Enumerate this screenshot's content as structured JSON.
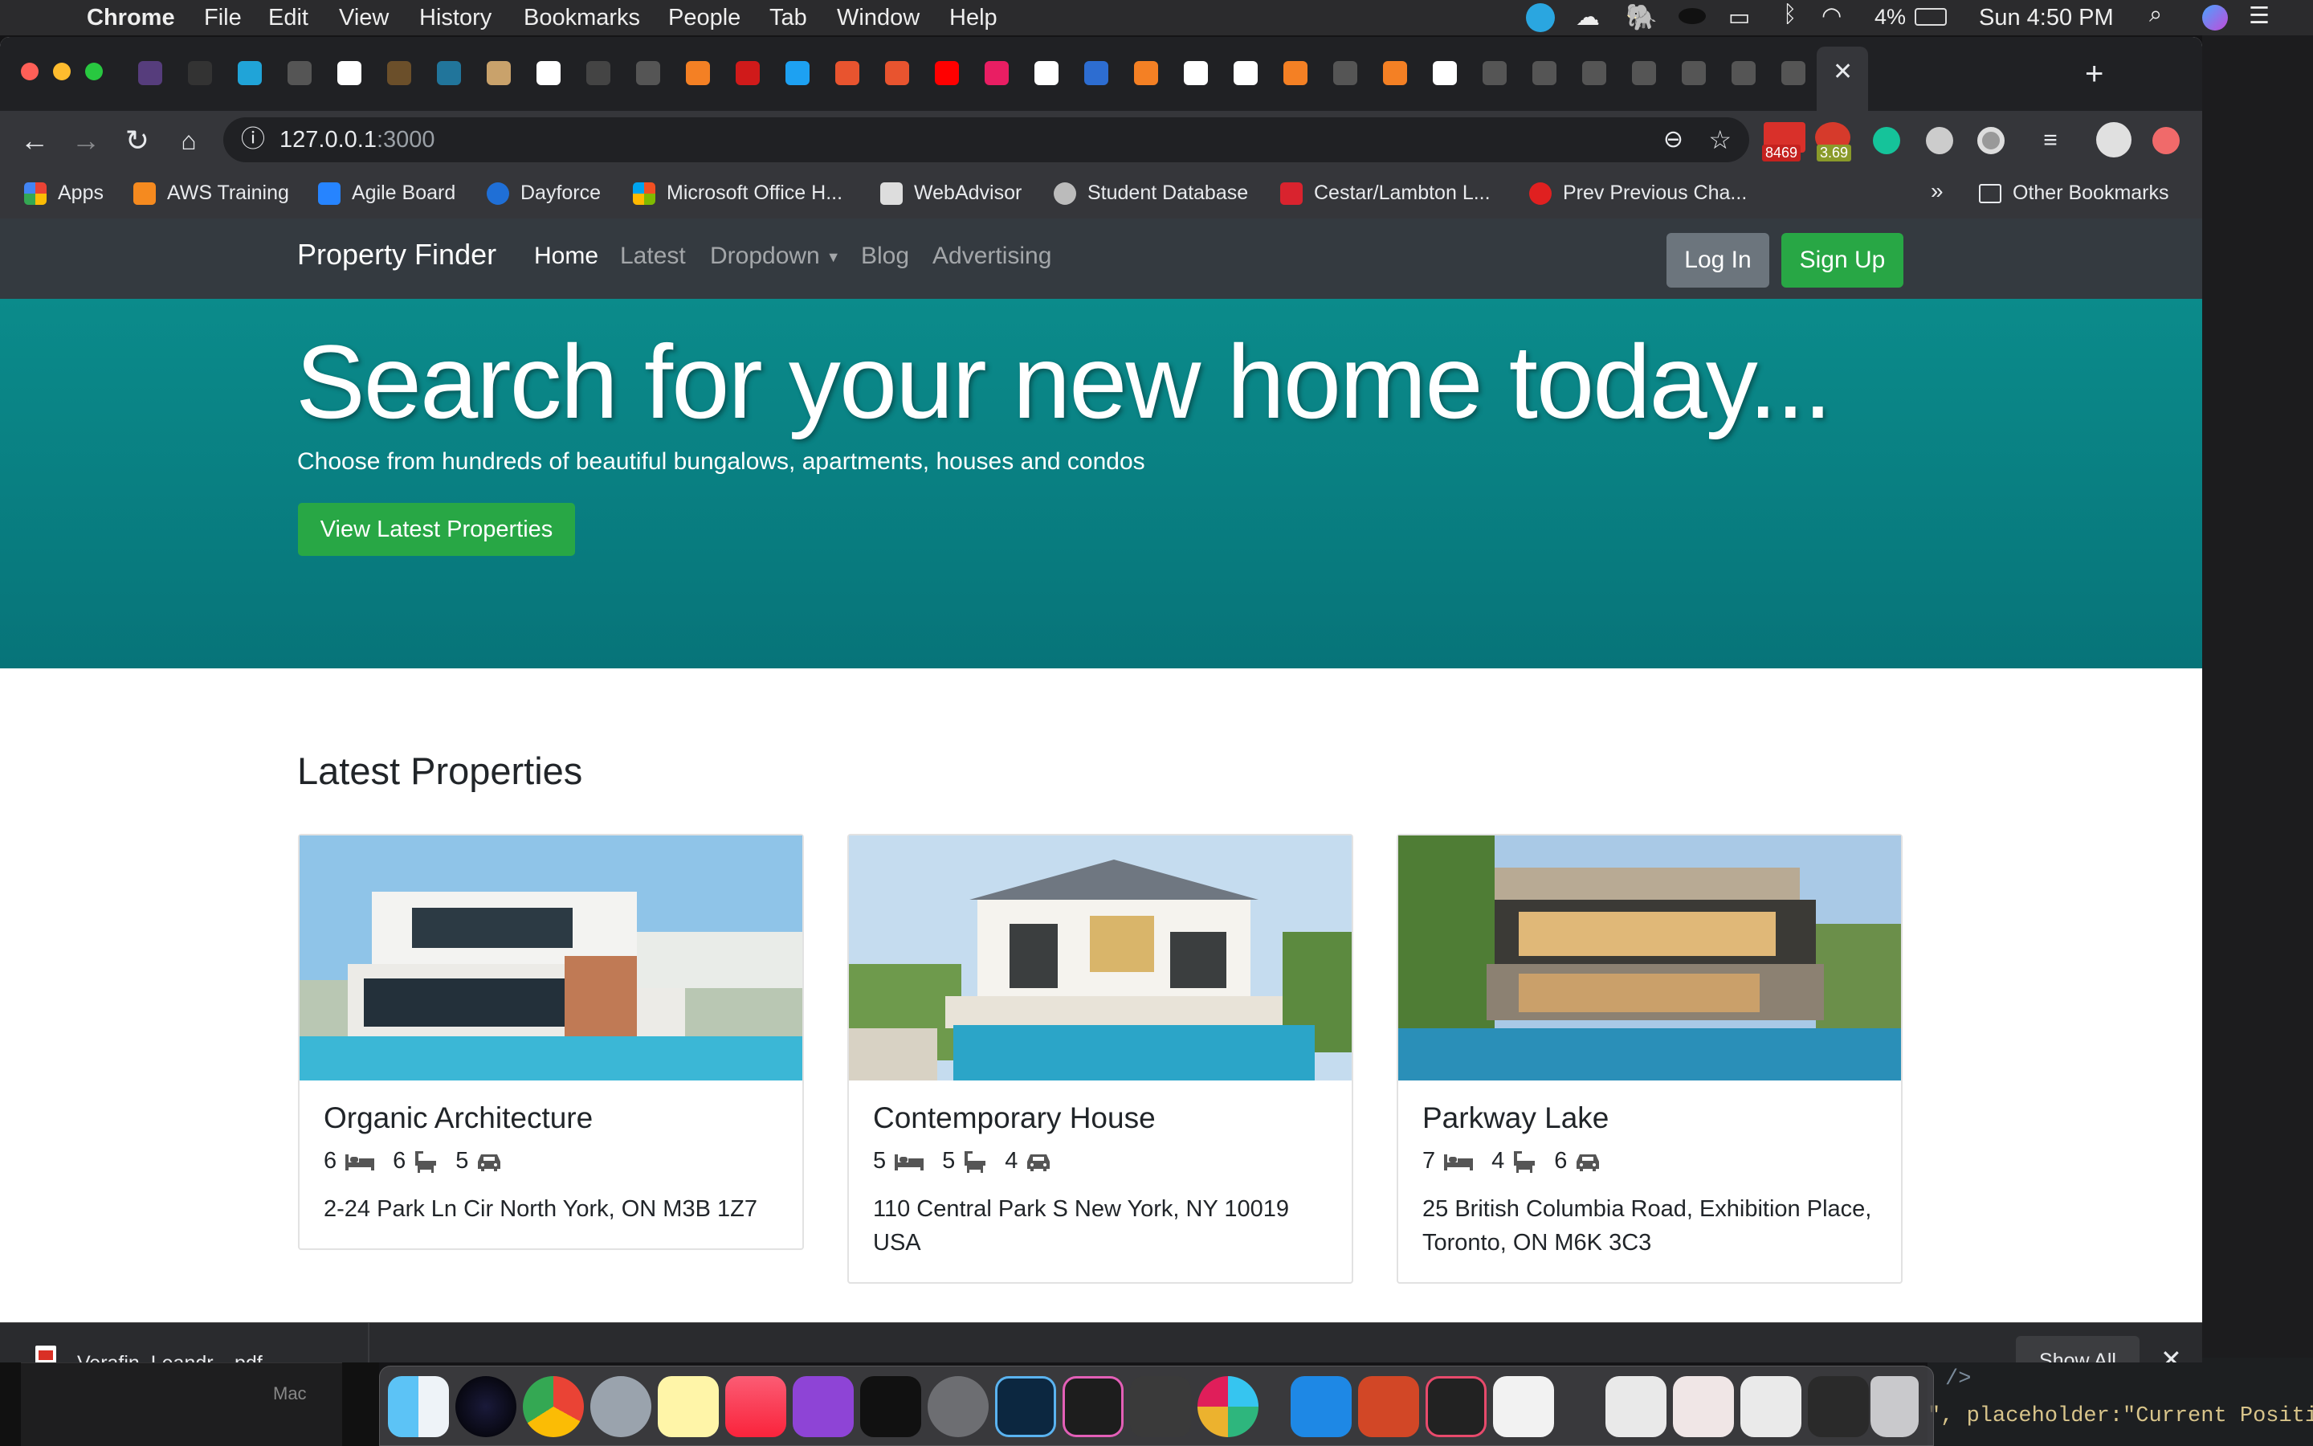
{
  "menubar": {
    "app": "Chrome",
    "items": [
      "File",
      "Edit",
      "View",
      "History",
      "Bookmarks",
      "People",
      "Tab",
      "Window",
      "Help"
    ],
    "battery": "4%",
    "clock": "Sun 4:50 PM"
  },
  "browser": {
    "url_host": "127.0.0.1",
    "url_port": ":3000",
    "ext_badge_1": "8469",
    "ext_badge_2": "3.69",
    "bookmarks": [
      "Apps",
      "AWS Training",
      "Agile Board",
      "Dayforce",
      "Microsoft Office H...",
      "WebAdvisor",
      "Student Database",
      "Cestar/Lambton L...",
      "Prev Previous Cha..."
    ],
    "bookmarks_overflow": "»",
    "other_bookmarks": "Other Bookmarks"
  },
  "site": {
    "brand": "Property Finder",
    "nav": [
      "Home",
      "Latest",
      "Dropdown",
      "Blog",
      "Advertising"
    ],
    "login": "Log In",
    "signup": "Sign Up",
    "hero_title": "Search for your new home today...",
    "hero_subtitle": "Choose from hundreds of beautiful bungalows, apartments, houses and condos",
    "hero_button": "View Latest Properties",
    "section_title": "Latest Properties",
    "properties": [
      {
        "title": "Organic Architecture",
        "bedrooms": "6",
        "bathrooms": "6",
        "garages": "5",
        "address": "2-24 Park Ln Cir North York, ON M3B 1Z7"
      },
      {
        "title": "Contemporary House",
        "bedrooms": "5",
        "bathrooms": "5",
        "garages": "4",
        "address": "110 Central Park S New York, NY 10019 USA"
      },
      {
        "title": "Parkway Lake",
        "bedrooms": "7",
        "bathrooms": "4",
        "garages": "6",
        "address": "25 British Columbia Road, Exhibition Place, Toronto, ON M6K 3C3"
      }
    ]
  },
  "downloads": {
    "file": "Verafin_Leandr....pdf",
    "show_all": "Show All"
  },
  "background": {
    "editor_line_1": "/>",
    "editor_line_2": "\", placeholder:\"Current Positi",
    "finder_label": "Mac"
  },
  "colors": {
    "accent_green": "#28a745",
    "hero_teal": "#0b8b8b",
    "navbar": "#343a40"
  }
}
